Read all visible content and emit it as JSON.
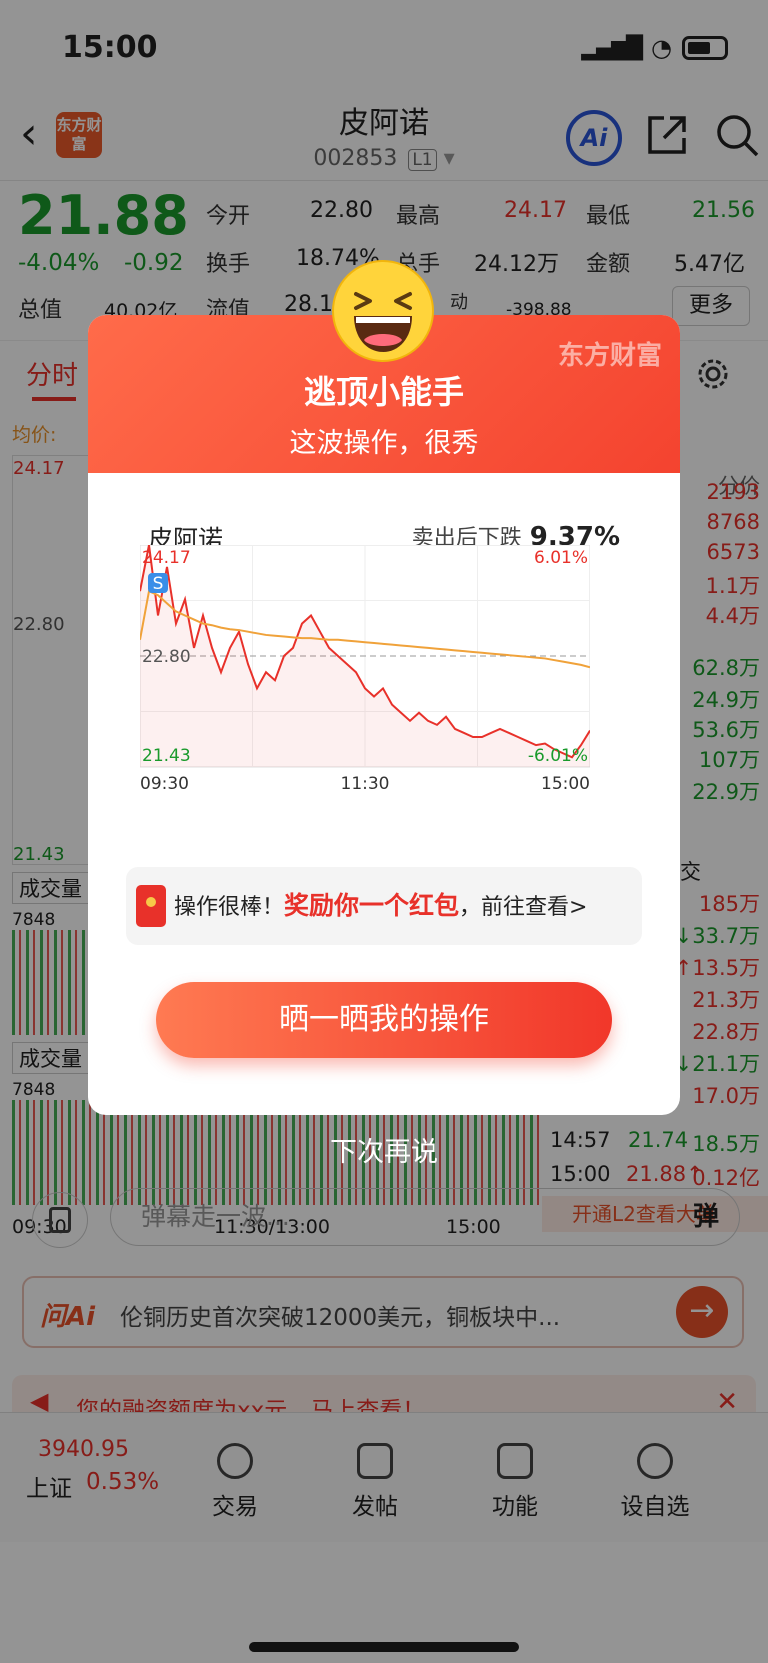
{
  "status": {
    "time": "15:00"
  },
  "header": {
    "logo_text": "东方财富",
    "title": "皮阿诺",
    "code": "002853",
    "level": "L1",
    "ai_label": "Ai"
  },
  "quote": {
    "price": "21.88",
    "change_pct": "-4.04%",
    "change": "-0.92",
    "open_label": "今开",
    "open": "22.80",
    "high_label": "最高",
    "high": "24.17",
    "low_label": "最低",
    "low": "21.56",
    "turnover_label": "换手",
    "turnover": "18.74%",
    "volume_label": "总手",
    "volume": "24.12万",
    "amount_label": "金额",
    "amount": "5.47亿",
    "mktcap_label": "总值",
    "mktcap": "40.02亿",
    "float_label": "流值",
    "float": "28.1",
    "move_label": "动",
    "move": "-398.88",
    "more_label": "更多"
  },
  "tabs": {
    "active": "分时",
    "avg_label": "均价:"
  },
  "bg_chart": {
    "hi": "24.17",
    "mid": "22.80",
    "lo": "21.43",
    "vol_label": "成交量",
    "vol_val": "7848",
    "t_start": "09:30",
    "t_mid": "11:30/13:00",
    "t_end": "15:00"
  },
  "side": {
    "header": "分价",
    "values": [
      "2193",
      "8768",
      "6573",
      "1.1万",
      "4.4万",
      "62.8万",
      "24.9万",
      "53.6万",
      "107万",
      "22.9万"
    ],
    "trade_header": "交",
    "trades": [
      "185万",
      "↓33.7万",
      "↑13.5万",
      "21.3万",
      "22.8万",
      "↓21.1万",
      "17.0万"
    ],
    "row1": {
      "time": "14:57",
      "price": "21.74",
      "vol": "18.5万"
    },
    "row2": {
      "time": "15:00",
      "price": "21.88↑",
      "vol": "0.12亿"
    },
    "l2": "开通L2查看大单"
  },
  "modal": {
    "brand": "东方财富",
    "title": "逃顶小能手",
    "subtitle": "这波操作，很秀",
    "stock_name": "皮阿诺",
    "sold_label": "卖出后下跌",
    "sold_value": "9.37%",
    "reward_prefix": "操作很棒！",
    "reward_highlight": "奖励你一个红包",
    "reward_suffix": "，前往查看>",
    "share_button": "晒一晒我的操作",
    "later": "下次再说"
  },
  "chart_data": {
    "type": "line",
    "title": "",
    "x_ticks": [
      "09:30",
      "11:30",
      "15:00"
    ],
    "ylim": [
      21.43,
      24.17
    ],
    "y_labels": {
      "high": "24.17",
      "mid": "22.80",
      "low": "21.43",
      "high_pct": "6.01%",
      "low_pct": "-6.01%"
    },
    "sell_marker": "S",
    "series": [
      {
        "name": "",
        "color": "#e8312a",
        "values": [
          23.6,
          24.17,
          23.3,
          23.9,
          23.2,
          23.5,
          22.9,
          23.3,
          22.9,
          22.6,
          22.9,
          23.1,
          22.7,
          22.4,
          22.6,
          22.5,
          22.8,
          22.9,
          23.2,
          23.3,
          23.1,
          22.9,
          22.8,
          22.7,
          22.6,
          22.4,
          22.3,
          22.4,
          22.2,
          22.1,
          22.0,
          22.1,
          22.0,
          21.95,
          22.05,
          21.9,
          21.85,
          21.8,
          21.8,
          21.85,
          21.9,
          21.85,
          21.8,
          21.75,
          21.7,
          21.72,
          21.65,
          21.6,
          21.55,
          21.7,
          21.88
        ]
      },
      {
        "name": "",
        "color": "#f0a23a",
        "values": [
          23.0,
          23.6,
          23.55,
          23.45,
          23.35,
          23.3,
          23.25,
          23.2,
          23.18,
          23.15,
          23.13,
          23.12,
          23.1,
          23.08,
          23.06,
          23.05,
          23.04,
          23.03,
          23.02,
          23.02,
          23.01,
          23.0,
          23.0,
          22.99,
          22.98,
          22.97,
          22.96,
          22.95,
          22.94,
          22.93,
          22.92,
          22.91,
          22.9,
          22.89,
          22.88,
          22.87,
          22.86,
          22.85,
          22.84,
          22.83,
          22.82,
          22.81,
          22.8,
          22.79,
          22.78,
          22.77,
          22.75,
          22.73,
          22.71,
          22.69,
          22.66
        ]
      }
    ]
  },
  "bottom": {
    "danmu_placeholder": "弹幕走一波...",
    "danmu_btn": "弹",
    "ask_logo": "问Ai",
    "ask_text": "伦铜历史首次突破12000美元，铜板块中...",
    "notice": "您的融资额度为xx元，马上查看！",
    "index_value": "3940.95",
    "index_name": "上证",
    "index_pct": "0.53%",
    "tabs": [
      "交易",
      "发帖",
      "功能",
      "设自选"
    ]
  }
}
